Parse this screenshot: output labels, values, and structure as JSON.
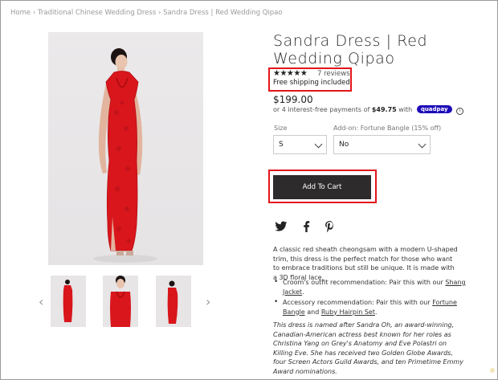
{
  "breadcrumb": {
    "home": "Home",
    "category": "Traditional Chinese Wedding Dress",
    "current": "Sandra Dress | Red Wedding Qipao",
    "separator": "›"
  },
  "product": {
    "title": "Sandra Dress | Red Wedding Qipao",
    "rating": 5,
    "stars": "★★★★★",
    "reviews": "7 reviews",
    "shipping": "Free shipping included",
    "price": "$199.00",
    "installments_prefix": "or 4 interest-free payments of",
    "installment_amount": "$49.75",
    "installments_suffix": "with",
    "payment_brand": "quadpay",
    "info": "i"
  },
  "options": {
    "size_label": "Size",
    "size_value": "S",
    "addon_label": "Add-on: Fortune Bangle (15% off)",
    "addon_value": "No"
  },
  "cart": {
    "button_label": "Add To Cart"
  },
  "social": {
    "twitter": "twitter-icon",
    "facebook": "facebook-icon",
    "pinterest": "pinterest-icon"
  },
  "description": {
    "intro": "A classic red sheath cheongsam with a modern U-shaped trim, this dress is the perfect match for those who want to embrace traditions but still be unique. It is made with a 3D floral lace.",
    "groom_prefix": "Croom's outfit recommendation: Pair this with our",
    "groom_link": "Shang Jacket",
    "groom_suffix": ".",
    "accessory_prefix": "Accessory recommendation: Pair this with our",
    "accessory_link1": "Fortune Bangle",
    "accessory_and": "and",
    "accessory_link2": "Ruby Hairpin Set",
    "accessory_suffix": ".",
    "note": "This dress is named after Sandra Oh, an award-winning, Canadian-American actress best known for her roles as Christina Yang on Grey's Anatomy and Eve Polastri on Killing Eve. She has received two Golden Globe Awards, four Screen Actors Guild Awards, and ten Primetime Emmy Award nominations."
  },
  "gallery": {
    "prev": "‹",
    "next": "›"
  },
  "colors": {
    "accent_red": "#e3151b",
    "dress_red": "#d8161c",
    "button_dark": "#2d2b2b",
    "quadpay_blue": "#1d0bb8"
  }
}
